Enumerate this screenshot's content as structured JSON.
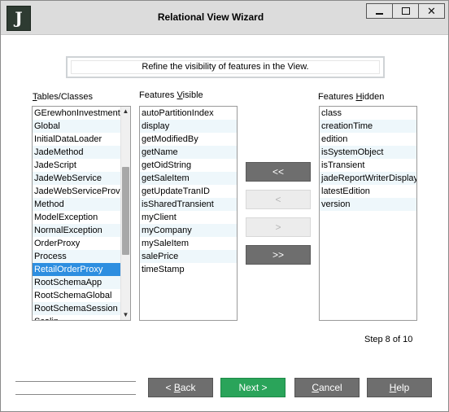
{
  "window": {
    "icon_letter": "J",
    "title": "Relational View Wizard",
    "controls": {
      "minimize": "minimize-icon",
      "maximize": "maximize-icon",
      "close": "✕"
    }
  },
  "header": {
    "instruction": "Refine the visibility of features in the View."
  },
  "tables": {
    "label_pre": "",
    "label_u": "T",
    "label_post": "ables/Classes",
    "items": [
      "GErewhonInvestments",
      "Global",
      "InitialDataLoader",
      "JadeMethod",
      "JadeScript",
      "JadeWebService",
      "JadeWebServiceProvid",
      "Method",
      "ModelException",
      "NormalException",
      "OrderProxy",
      "Process",
      "RetailOrderProxy",
      "RootSchemaApp",
      "RootSchemaGlobal",
      "RootSchemaSession",
      "Scalin"
    ],
    "selected_index": 12,
    "scroll_up": "▲",
    "scroll_down": "▼"
  },
  "visible": {
    "label_pre": "Features ",
    "label_u": "V",
    "label_post": "isible",
    "items": [
      "autoPartitionIndex",
      "display",
      "getModifiedBy",
      "getName",
      "getOidString",
      "getSaleItem",
      "getUpdateTranID",
      "isSharedTransient",
      "myClient",
      "myCompany",
      "mySaleItem",
      "salePrice",
      "timeStamp"
    ]
  },
  "hidden": {
    "label_pre": "Features ",
    "label_u": "H",
    "label_post": "idden",
    "items": [
      "class",
      "creationTime",
      "edition",
      "isSystemObject",
      "isTransient",
      "jadeReportWriterDisplay",
      "latestEdition",
      "version"
    ]
  },
  "move_buttons": {
    "all_left": "<<",
    "left": "<",
    "right": ">",
    "all_right": ">>"
  },
  "step": "Step 8 of 10",
  "nav": {
    "back": {
      "pre": "< ",
      "u": "B",
      "post": "ack"
    },
    "next": "Next >",
    "cancel": {
      "pre": "",
      "u": "C",
      "post": "ancel"
    },
    "help": {
      "pre": "",
      "u": "H",
      "post": "elp"
    }
  },
  "colors": {
    "selected": "#2d8ee0",
    "alt_row": "#eef7fb",
    "button": "#6e6e6e",
    "primary": "#2aa45a"
  }
}
